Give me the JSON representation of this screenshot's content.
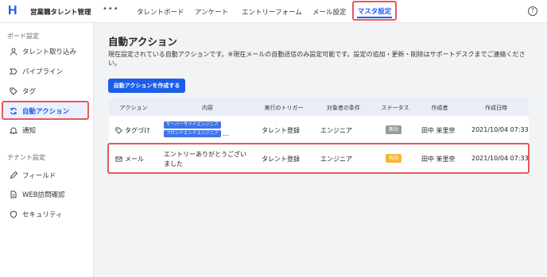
{
  "app": {
    "logo": "H",
    "name": "営業職タレント管理",
    "more": "•••"
  },
  "nav": {
    "items": [
      "タレントボード",
      "アンケート",
      "エントリーフォーム",
      "メール設定"
    ],
    "active": "マスタ設定",
    "help": "?"
  },
  "sidebar": {
    "board_section": "ボード設定",
    "board_items": [
      {
        "label": "タレント取り込み",
        "icon": "person-icon"
      },
      {
        "label": "パイプライン",
        "icon": "pipeline-icon"
      },
      {
        "label": "タグ",
        "icon": "tag-icon"
      }
    ],
    "active_item": {
      "label": "自動アクション",
      "icon": "refresh-icon"
    },
    "notify_item": {
      "label": "通知",
      "icon": "bell-icon"
    },
    "tenant_section": "テナント設定",
    "tenant_items": [
      {
        "label": "フィールド",
        "icon": "pencil-icon"
      },
      {
        "label": "WEB訪問確認",
        "icon": "document-icon"
      },
      {
        "label": "セキュリティ",
        "icon": "shield-icon"
      }
    ]
  },
  "main": {
    "title": "自動アクション",
    "description": "現在設定されている自動アクションです。※現在メールの自動送信のみ設定可能です。設定の追加・更新・削除はサポートデスクまでご連絡ください。",
    "create_button": "自動アクションを作成する"
  },
  "table": {
    "headers": [
      "アクション",
      "内容",
      "実行のトリガー",
      "対象者の条件",
      "ステータス",
      "作成者",
      "作成日時"
    ],
    "rows": [
      {
        "action": "タグづけ",
        "action_icon": "tag-icon",
        "tags": [
          "サーバーサイドエンジニア",
          "フロントエンドエンジニア"
        ],
        "tags_more": "...",
        "trigger": "タレント登録",
        "condition": "エンジニア",
        "status": "無効",
        "status_color": "#9a9a9a",
        "creator": "田中 茉里奈",
        "created_at": "2021/10/04 07:33"
      },
      {
        "action": "メール",
        "action_icon": "mail-icon",
        "content_line1": "エントリーありがとうござい",
        "content_line2": "ました",
        "trigger": "タレント登録",
        "condition": "エンジニア",
        "status": "有効",
        "status_color": "#f5b731",
        "creator": "田中 茉里奈",
        "created_at": "2021/10/04 07:33"
      }
    ]
  },
  "colors": {
    "accent": "#1c5ee8",
    "highlight": "#e9585a",
    "header_bg": "#e9eef6"
  }
}
